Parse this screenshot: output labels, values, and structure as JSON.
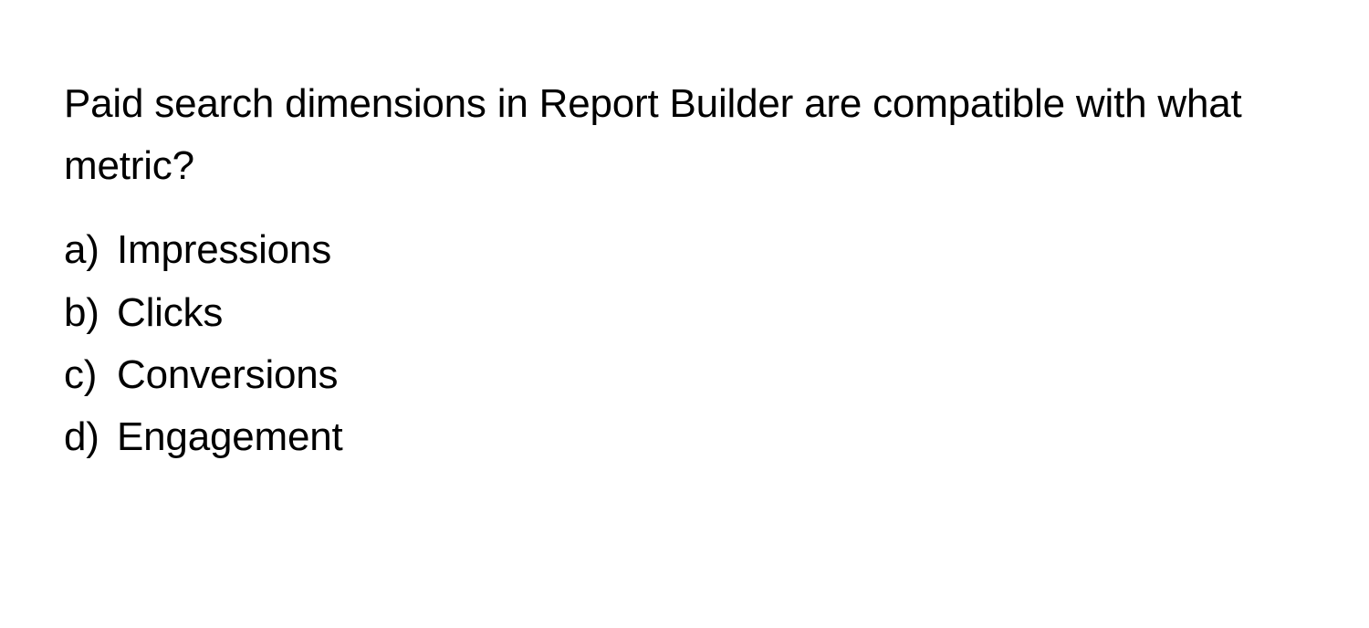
{
  "question": "Paid search dimensions in Report Builder are compatible with what metric?",
  "options": [
    {
      "label": "a)",
      "text": "Impressions"
    },
    {
      "label": "b)",
      "text": "Clicks"
    },
    {
      "label": "c)",
      "text": "Conversions"
    },
    {
      "label": "d)",
      "text": "Engagement"
    }
  ]
}
